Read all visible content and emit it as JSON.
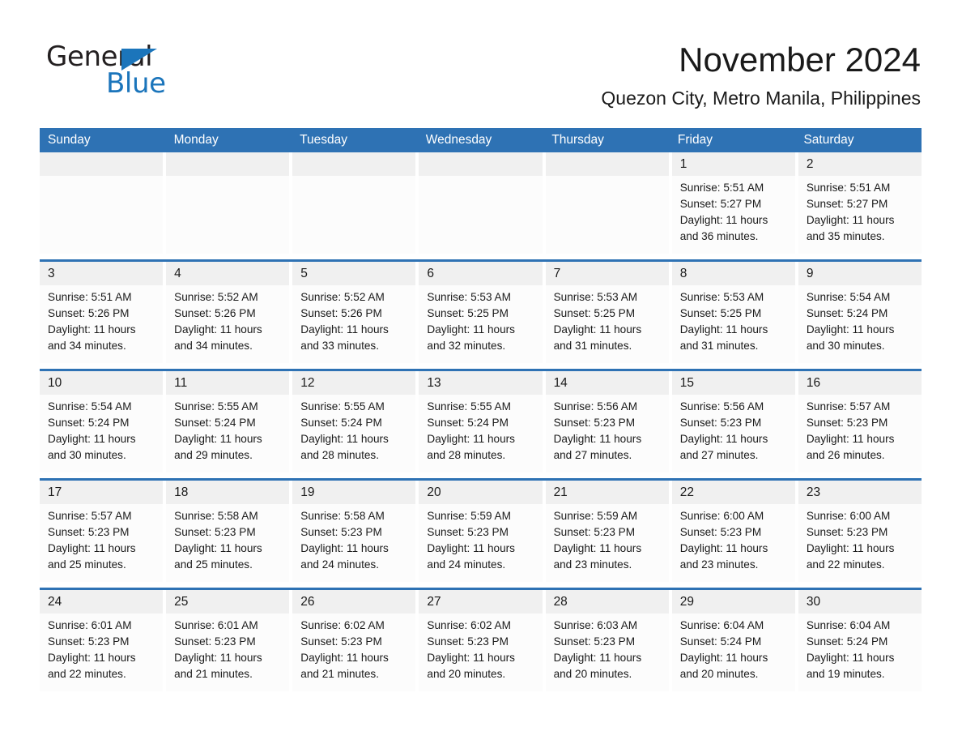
{
  "brand": {
    "name_part1": "General",
    "name_part2": "Blue",
    "logo_icon": "triangle-flag-icon",
    "accent_color": "#1b75bb"
  },
  "header": {
    "month_title": "November 2024",
    "location": "Quezon City, Metro Manila, Philippines"
  },
  "calendar": {
    "header_color": "#2e72b4",
    "weekdays": [
      "Sunday",
      "Monday",
      "Tuesday",
      "Wednesday",
      "Thursday",
      "Friday",
      "Saturday"
    ],
    "weeks": [
      [
        {
          "day": "",
          "empty": true
        },
        {
          "day": "",
          "empty": true
        },
        {
          "day": "",
          "empty": true
        },
        {
          "day": "",
          "empty": true
        },
        {
          "day": "",
          "empty": true
        },
        {
          "day": "1",
          "sunrise": "Sunrise: 5:51 AM",
          "sunset": "Sunset: 5:27 PM",
          "daylight_line1": "Daylight: 11 hours",
          "daylight_line2": "and 36 minutes."
        },
        {
          "day": "2",
          "sunrise": "Sunrise: 5:51 AM",
          "sunset": "Sunset: 5:27 PM",
          "daylight_line1": "Daylight: 11 hours",
          "daylight_line2": "and 35 minutes."
        }
      ],
      [
        {
          "day": "3",
          "sunrise": "Sunrise: 5:51 AM",
          "sunset": "Sunset: 5:26 PM",
          "daylight_line1": "Daylight: 11 hours",
          "daylight_line2": "and 34 minutes."
        },
        {
          "day": "4",
          "sunrise": "Sunrise: 5:52 AM",
          "sunset": "Sunset: 5:26 PM",
          "daylight_line1": "Daylight: 11 hours",
          "daylight_line2": "and 34 minutes."
        },
        {
          "day": "5",
          "sunrise": "Sunrise: 5:52 AM",
          "sunset": "Sunset: 5:26 PM",
          "daylight_line1": "Daylight: 11 hours",
          "daylight_line2": "and 33 minutes."
        },
        {
          "day": "6",
          "sunrise": "Sunrise: 5:53 AM",
          "sunset": "Sunset: 5:25 PM",
          "daylight_line1": "Daylight: 11 hours",
          "daylight_line2": "and 32 minutes."
        },
        {
          "day": "7",
          "sunrise": "Sunrise: 5:53 AM",
          "sunset": "Sunset: 5:25 PM",
          "daylight_line1": "Daylight: 11 hours",
          "daylight_line2": "and 31 minutes."
        },
        {
          "day": "8",
          "sunrise": "Sunrise: 5:53 AM",
          "sunset": "Sunset: 5:25 PM",
          "daylight_line1": "Daylight: 11 hours",
          "daylight_line2": "and 31 minutes."
        },
        {
          "day": "9",
          "sunrise": "Sunrise: 5:54 AM",
          "sunset": "Sunset: 5:24 PM",
          "daylight_line1": "Daylight: 11 hours",
          "daylight_line2": "and 30 minutes."
        }
      ],
      [
        {
          "day": "10",
          "sunrise": "Sunrise: 5:54 AM",
          "sunset": "Sunset: 5:24 PM",
          "daylight_line1": "Daylight: 11 hours",
          "daylight_line2": "and 30 minutes."
        },
        {
          "day": "11",
          "sunrise": "Sunrise: 5:55 AM",
          "sunset": "Sunset: 5:24 PM",
          "daylight_line1": "Daylight: 11 hours",
          "daylight_line2": "and 29 minutes."
        },
        {
          "day": "12",
          "sunrise": "Sunrise: 5:55 AM",
          "sunset": "Sunset: 5:24 PM",
          "daylight_line1": "Daylight: 11 hours",
          "daylight_line2": "and 28 minutes."
        },
        {
          "day": "13",
          "sunrise": "Sunrise: 5:55 AM",
          "sunset": "Sunset: 5:24 PM",
          "daylight_line1": "Daylight: 11 hours",
          "daylight_line2": "and 28 minutes."
        },
        {
          "day": "14",
          "sunrise": "Sunrise: 5:56 AM",
          "sunset": "Sunset: 5:23 PM",
          "daylight_line1": "Daylight: 11 hours",
          "daylight_line2": "and 27 minutes."
        },
        {
          "day": "15",
          "sunrise": "Sunrise: 5:56 AM",
          "sunset": "Sunset: 5:23 PM",
          "daylight_line1": "Daylight: 11 hours",
          "daylight_line2": "and 27 minutes."
        },
        {
          "day": "16",
          "sunrise": "Sunrise: 5:57 AM",
          "sunset": "Sunset: 5:23 PM",
          "daylight_line1": "Daylight: 11 hours",
          "daylight_line2": "and 26 minutes."
        }
      ],
      [
        {
          "day": "17",
          "sunrise": "Sunrise: 5:57 AM",
          "sunset": "Sunset: 5:23 PM",
          "daylight_line1": "Daylight: 11 hours",
          "daylight_line2": "and 25 minutes."
        },
        {
          "day": "18",
          "sunrise": "Sunrise: 5:58 AM",
          "sunset": "Sunset: 5:23 PM",
          "daylight_line1": "Daylight: 11 hours",
          "daylight_line2": "and 25 minutes."
        },
        {
          "day": "19",
          "sunrise": "Sunrise: 5:58 AM",
          "sunset": "Sunset: 5:23 PM",
          "daylight_line1": "Daylight: 11 hours",
          "daylight_line2": "and 24 minutes."
        },
        {
          "day": "20",
          "sunrise": "Sunrise: 5:59 AM",
          "sunset": "Sunset: 5:23 PM",
          "daylight_line1": "Daylight: 11 hours",
          "daylight_line2": "and 24 minutes."
        },
        {
          "day": "21",
          "sunrise": "Sunrise: 5:59 AM",
          "sunset": "Sunset: 5:23 PM",
          "daylight_line1": "Daylight: 11 hours",
          "daylight_line2": "and 23 minutes."
        },
        {
          "day": "22",
          "sunrise": "Sunrise: 6:00 AM",
          "sunset": "Sunset: 5:23 PM",
          "daylight_line1": "Daylight: 11 hours",
          "daylight_line2": "and 23 minutes."
        },
        {
          "day": "23",
          "sunrise": "Sunrise: 6:00 AM",
          "sunset": "Sunset: 5:23 PM",
          "daylight_line1": "Daylight: 11 hours",
          "daylight_line2": "and 22 minutes."
        }
      ],
      [
        {
          "day": "24",
          "sunrise": "Sunrise: 6:01 AM",
          "sunset": "Sunset: 5:23 PM",
          "daylight_line1": "Daylight: 11 hours",
          "daylight_line2": "and 22 minutes."
        },
        {
          "day": "25",
          "sunrise": "Sunrise: 6:01 AM",
          "sunset": "Sunset: 5:23 PM",
          "daylight_line1": "Daylight: 11 hours",
          "daylight_line2": "and 21 minutes."
        },
        {
          "day": "26",
          "sunrise": "Sunrise: 6:02 AM",
          "sunset": "Sunset: 5:23 PM",
          "daylight_line1": "Daylight: 11 hours",
          "daylight_line2": "and 21 minutes."
        },
        {
          "day": "27",
          "sunrise": "Sunrise: 6:02 AM",
          "sunset": "Sunset: 5:23 PM",
          "daylight_line1": "Daylight: 11 hours",
          "daylight_line2": "and 20 minutes."
        },
        {
          "day": "28",
          "sunrise": "Sunrise: 6:03 AM",
          "sunset": "Sunset: 5:23 PM",
          "daylight_line1": "Daylight: 11 hours",
          "daylight_line2": "and 20 minutes."
        },
        {
          "day": "29",
          "sunrise": "Sunrise: 6:04 AM",
          "sunset": "Sunset: 5:24 PM",
          "daylight_line1": "Daylight: 11 hours",
          "daylight_line2": "and 20 minutes."
        },
        {
          "day": "30",
          "sunrise": "Sunrise: 6:04 AM",
          "sunset": "Sunset: 5:24 PM",
          "daylight_line1": "Daylight: 11 hours",
          "daylight_line2": "and 19 minutes."
        }
      ]
    ]
  }
}
